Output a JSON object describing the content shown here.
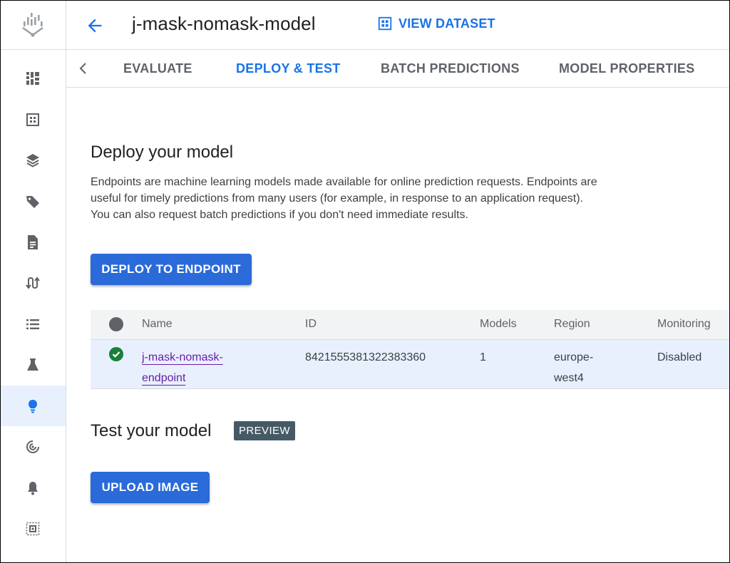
{
  "header": {
    "title": "j-mask-nomask-model",
    "view_dataset_label": "VIEW DATASET"
  },
  "tabs": [
    {
      "label": "EVALUATE"
    },
    {
      "label": "DEPLOY & TEST",
      "active": true
    },
    {
      "label": "BATCH PREDICTIONS"
    },
    {
      "label": "MODEL PROPERTIES"
    }
  ],
  "sidebar": {
    "items": [
      {
        "icon": "dashboard-icon"
      },
      {
        "icon": "datasets-icon"
      },
      {
        "icon": "feature-store-icon"
      },
      {
        "icon": "labeling-tag-icon"
      },
      {
        "icon": "notebooks-icon"
      },
      {
        "icon": "pipelines-icon"
      },
      {
        "icon": "training-list-icon"
      },
      {
        "icon": "experiments-flask-icon"
      },
      {
        "icon": "models-lightbulb-icon",
        "active": true
      },
      {
        "icon": "endpoints-target-icon"
      },
      {
        "icon": "notifications-bell-icon"
      },
      {
        "icon": "matching-engine-icon"
      }
    ]
  },
  "deploy": {
    "heading": "Deploy your model",
    "description": "Endpoints are machine learning models made available for online prediction requests. Endpoints are useful for timely predictions from many users (for example, in response to an application request). You can also request batch predictions if you don't need immediate results.",
    "button_label": "DEPLOY TO ENDPOINT"
  },
  "endpoints_table": {
    "columns": [
      "Name",
      "ID",
      "Models",
      "Region",
      "Monitoring"
    ],
    "rows": [
      {
        "status": "active",
        "name_line1": "j-mask-nomask-",
        "name_line2": "endpoint",
        "id": "8421555381322383360",
        "models": "1",
        "region_line1": "europe-",
        "region_line2": "west4",
        "monitoring": "Disabled"
      }
    ]
  },
  "test": {
    "heading": "Test your model",
    "badge": "PREVIEW",
    "button_label": "UPLOAD IMAGE"
  },
  "colors": {
    "accent": "#1a73e8",
    "button": "#2a6ad9",
    "success": "#188038",
    "link": "#681da8",
    "badge": "#455a64"
  }
}
